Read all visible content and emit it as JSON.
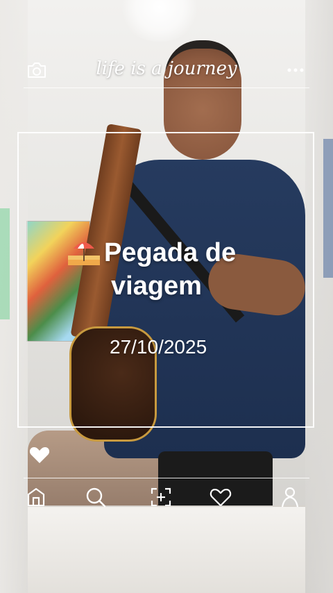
{
  "brand": "life is a journey",
  "post": {
    "title_line1": "Pegada de",
    "title_line2": "viagem",
    "date": "27/10/2025"
  },
  "icons": {
    "camera": "camera-icon",
    "more": "more-icon",
    "like": "heart-icon",
    "home": "home-icon",
    "search": "search-icon",
    "add": "add-post-icon",
    "favorites": "heart-outline-icon",
    "profile": "profile-icon"
  },
  "colors": {
    "overlay_text": "#ffffff",
    "shirt": "#263b5f"
  }
}
